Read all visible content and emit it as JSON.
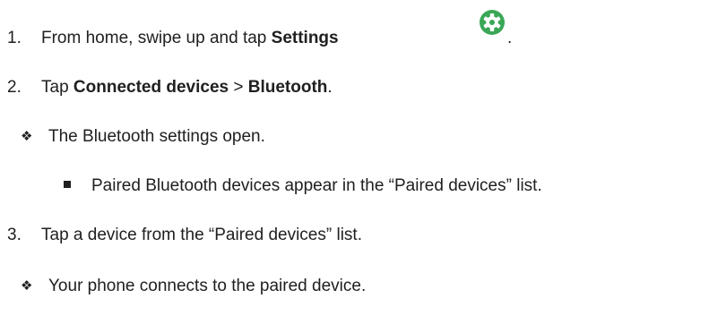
{
  "steps": {
    "step1": {
      "number": "1.",
      "text_before": "From home, swipe up and tap ",
      "bold": "Settings",
      "text_after": ".",
      "icon": "settings-gear-icon",
      "icon_color": "#3aa757"
    },
    "step2": {
      "number": "2.",
      "text_before": "Tap ",
      "bold1": "Connected devices",
      "separator": " > ",
      "bold2": "Bluetooth",
      "text_after": "."
    },
    "note1": {
      "bullet": "❖",
      "text": "The Bluetooth settings open."
    },
    "subnote1": {
      "text": "Paired Bluetooth devices appear in the “Paired devices” list."
    },
    "step3": {
      "number": "3.",
      "text": "Tap a device from the “Paired devices” list."
    },
    "note2": {
      "bullet": "❖",
      "text": "Your phone connects to the paired device."
    }
  }
}
